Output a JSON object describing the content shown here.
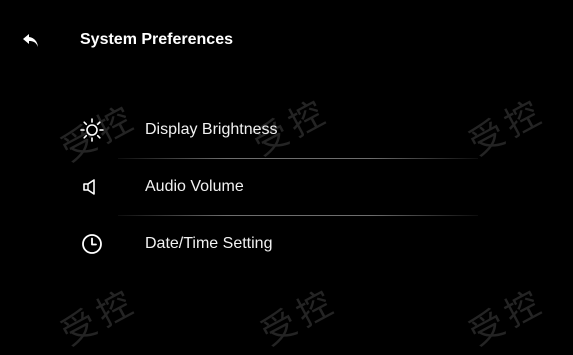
{
  "header": {
    "title": "System Preferences",
    "back_icon": "back-arrow-icon"
  },
  "menu": {
    "items": [
      {
        "label": "Display Brightness",
        "icon": "brightness-icon"
      },
      {
        "label": "Audio Volume",
        "icon": "speaker-icon"
      },
      {
        "label": "Date/Time Setting",
        "icon": "clock-icon"
      }
    ]
  },
  "watermark": {
    "text": "受控"
  },
  "colors": {
    "background": "#000000",
    "text": "#ffffff",
    "divider": "#bfbfbf"
  }
}
